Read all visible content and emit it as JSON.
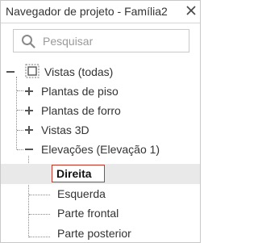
{
  "window": {
    "title": "Navegador de projeto - Família2",
    "close_icon": "close-icon"
  },
  "search": {
    "placeholder": "Pesquisar",
    "value": "",
    "icon": "search-icon"
  },
  "tree": {
    "root": {
      "label": "Vistas (todas)",
      "expanded": true,
      "icon": "views-icon"
    },
    "children": [
      {
        "label": "Plantas de piso",
        "expanded": false
      },
      {
        "label": "Plantas de forro",
        "expanded": false
      },
      {
        "label": "Vistas 3D",
        "expanded": false
      },
      {
        "label": "Elevações (Elevação 1)",
        "expanded": true
      }
    ],
    "elevations": [
      {
        "label": "Direita",
        "selected": true
      },
      {
        "label": "Esquerda",
        "selected": false
      },
      {
        "label": "Parte frontal",
        "selected": false
      },
      {
        "label": "Parte posterior",
        "selected": false
      }
    ]
  },
  "colors": {
    "selection_border": "#c0392b",
    "selection_row": "#e9e9e9",
    "text": "#333333",
    "placeholder": "#9a9a9a"
  }
}
